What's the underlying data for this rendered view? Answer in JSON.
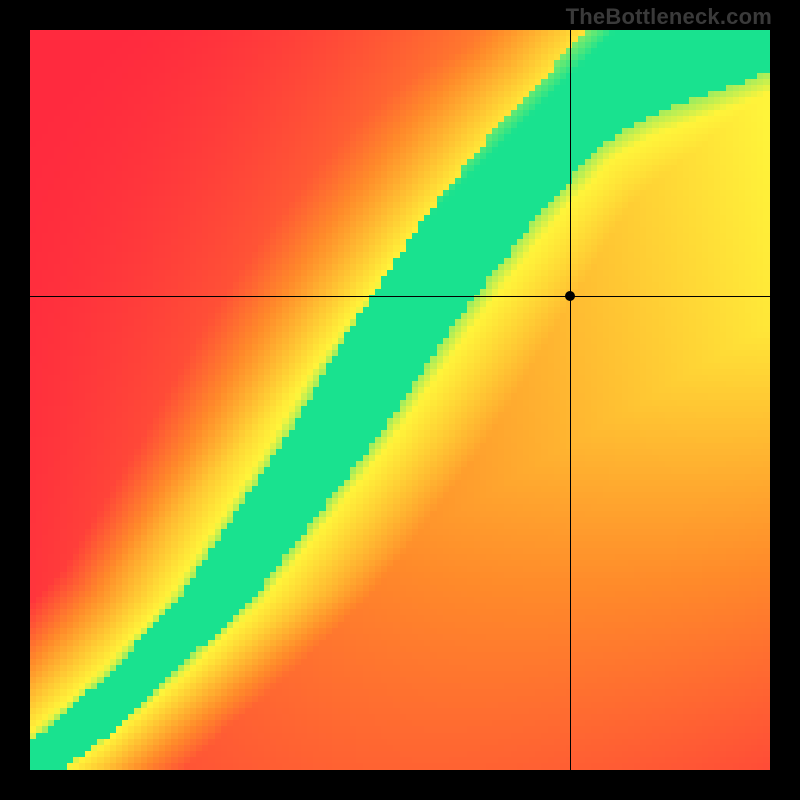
{
  "watermark": "TheBottleneck.com",
  "chart_data": {
    "type": "heatmap",
    "title": "",
    "xlabel": "",
    "ylabel": "",
    "xlim": [
      0,
      1
    ],
    "ylim": [
      0,
      1
    ],
    "grid": false,
    "legend": false,
    "annotations": [],
    "grid_resolution": 120,
    "color_stops": {
      "red": "#ff2a3e",
      "orange": "#ff8a2a",
      "yellow": "#fff43a",
      "green": "#19e28f"
    },
    "optimal_curve_xy": [
      [
        0.0,
        0.0
      ],
      [
        0.05,
        0.04
      ],
      [
        0.1,
        0.08
      ],
      [
        0.15,
        0.13
      ],
      [
        0.2,
        0.18
      ],
      [
        0.25,
        0.23
      ],
      [
        0.3,
        0.3
      ],
      [
        0.35,
        0.37
      ],
      [
        0.4,
        0.44
      ],
      [
        0.45,
        0.52
      ],
      [
        0.5,
        0.6
      ],
      [
        0.55,
        0.67
      ],
      [
        0.6,
        0.74
      ],
      [
        0.65,
        0.8
      ],
      [
        0.7,
        0.86
      ],
      [
        0.75,
        0.91
      ],
      [
        0.8,
        0.95
      ],
      [
        0.85,
        0.98
      ],
      [
        0.9,
        1.0
      ]
    ],
    "crosshair": {
      "x": 0.73,
      "y": 0.64
    },
    "marker": {
      "x": 0.73,
      "y": 0.64
    }
  }
}
